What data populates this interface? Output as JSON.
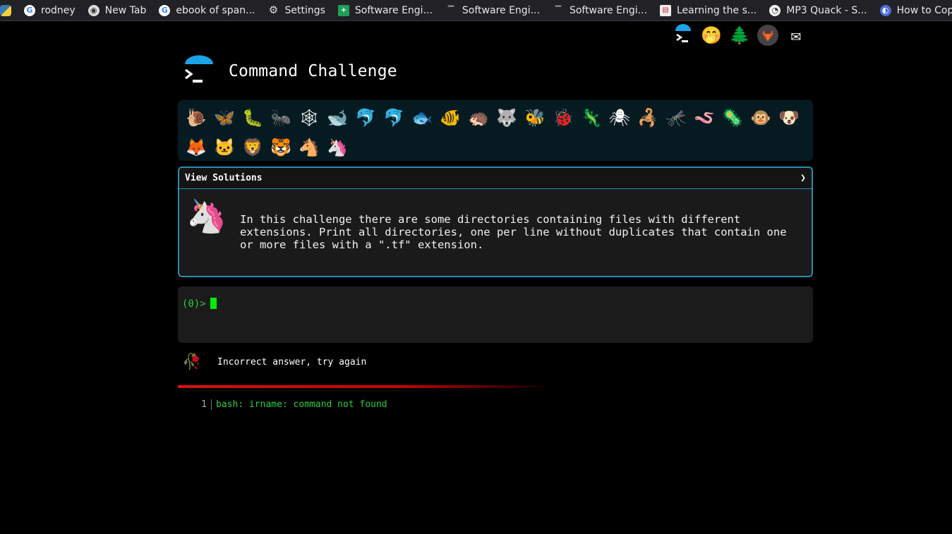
{
  "bookmarks": [
    {
      "icon": "python-icon",
      "label": ""
    },
    {
      "icon": "google-icon",
      "label": "rodney"
    },
    {
      "icon": "globe-icon",
      "label": "New Tab"
    },
    {
      "icon": "google-icon",
      "label": "ebook of span..."
    },
    {
      "icon": "gear-icon",
      "label": "Settings"
    },
    {
      "icon": "sheets-icon",
      "label": "Software Engi..."
    },
    {
      "icon": "dash-icon",
      "label": "Software Engi..."
    },
    {
      "icon": "dash-icon",
      "label": "Software Engi..."
    },
    {
      "icon": "doc-icon",
      "label": "Learning the s..."
    },
    {
      "icon": "duck-icon",
      "label": "MP3 Quack - S..."
    },
    {
      "icon": "blue-icon",
      "label": "How to Copy F..."
    }
  ],
  "top_icons": [
    "terminal-umbrella-icon",
    "face-icon",
    "tree-icon",
    "gitlab-icon",
    "mail-icon"
  ],
  "header": {
    "title": "Command Challenge"
  },
  "levels": [
    "🐌",
    "🦋",
    "🐛",
    "🐜",
    "🕸",
    "🐋",
    "🐬",
    "🐬",
    "🐟",
    "🐠",
    "🦔",
    "🐺",
    "🐝",
    "🐞",
    "🦎",
    "🕷",
    "🦂",
    "🦟",
    "🪱",
    "🦠",
    "🐵",
    "🐶",
    "🦊",
    "🐱",
    "🦁",
    "🐯",
    "🐴",
    "🦄"
  ],
  "challenge": {
    "solutions_label": "View Solutions",
    "solutions_chevron": "❯",
    "icon": "🦄",
    "description": "In this challenge there are some directories containing files with different extensions. Print all directories, one per line without duplicates that contain one or more files with a \".tf\" extension."
  },
  "terminal": {
    "prompt": "(0)>"
  },
  "result": {
    "icon": "🥀",
    "message": "Incorrect answer, try again"
  },
  "output": [
    {
      "line": "1",
      "text": "bash: irname: command not found"
    }
  ],
  "colors": {
    "accent": "#2a8cae",
    "prompt": "#2ecc40",
    "error": "#dd1111"
  }
}
